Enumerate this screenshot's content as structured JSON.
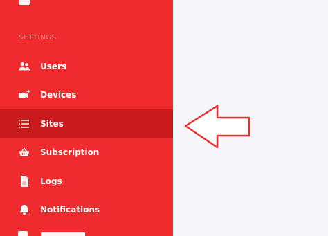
{
  "sidebar": {
    "section_label": "SETTINGS",
    "items": [
      {
        "name": "users",
        "label": "Users",
        "icon": "users-icon"
      },
      {
        "name": "devices",
        "label": "Devices",
        "icon": "video-plus-icon"
      },
      {
        "name": "sites",
        "label": "Sites",
        "icon": "list-icon",
        "active": true
      },
      {
        "name": "subscription",
        "label": "Subscription",
        "icon": "basket-icon"
      },
      {
        "name": "logs",
        "label": "Logs",
        "icon": "document-icon"
      },
      {
        "name": "notifications",
        "label": "Notifications",
        "icon": "bell-icon"
      }
    ]
  },
  "colors": {
    "sidebar_bg": "#ef2b2d",
    "active_bg": "#c91a1d",
    "content_bg": "#f7f7fb",
    "annotation_arrow": "#ef2b2d"
  }
}
